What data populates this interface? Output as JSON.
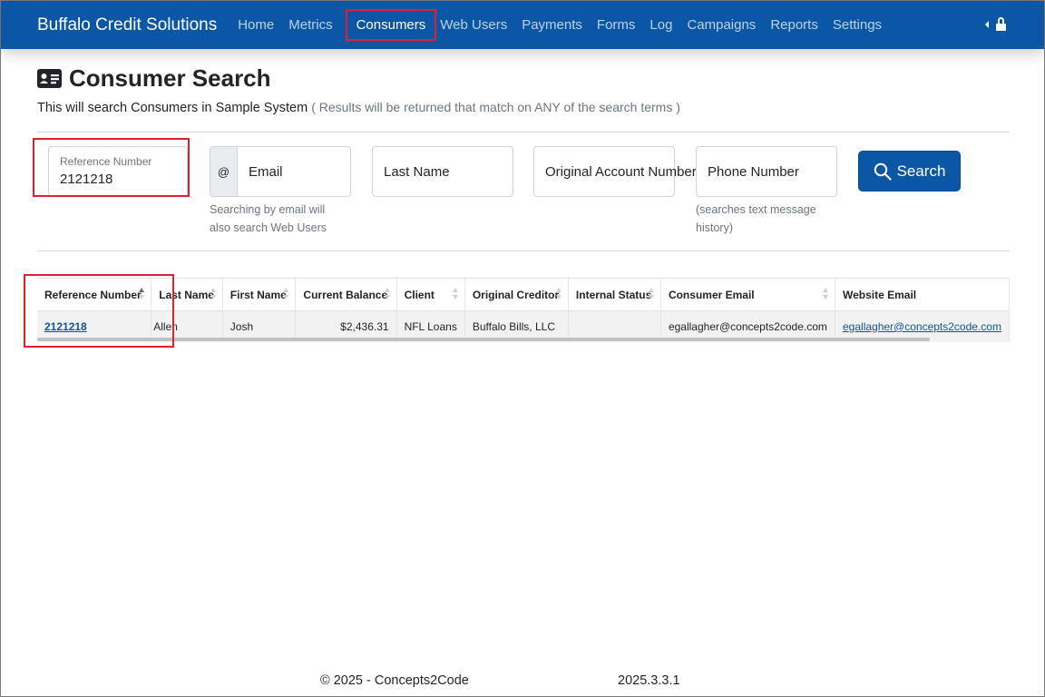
{
  "navbar": {
    "brand": "Buffalo Credit Solutions",
    "items": [
      {
        "label": "Home"
      },
      {
        "label": "Metrics"
      },
      {
        "label": "Consumers"
      },
      {
        "label": "Web Users"
      },
      {
        "label": "Payments"
      },
      {
        "label": "Forms"
      },
      {
        "label": "Log"
      },
      {
        "label": "Campaigns"
      },
      {
        "label": "Reports"
      },
      {
        "label": "Settings"
      }
    ],
    "active": "Consumers",
    "icons": [
      "caret-left-icon",
      "lock-icon"
    ]
  },
  "page": {
    "title": "Consumer Search",
    "title_icon": "id-card-icon",
    "subtitle": "This will search Consumers in Sample System",
    "subtitle_note": "( Results will be returned that match on ANY of the search terms )"
  },
  "search": {
    "reference_label": "Reference Number",
    "reference_value": "2121218",
    "email_addon": "@",
    "email_placeholder": "Email",
    "email_help": "Searching by email will also search Web Users",
    "last_name_placeholder": "Last Name",
    "original_account_placeholder": "Original Account Number",
    "phone_placeholder": "Phone Number",
    "phone_help": "(searches text message history)",
    "button_label": "Search",
    "button_icon": "search-icon"
  },
  "results": {
    "columns": [
      "Reference Number",
      "Last Name",
      "First Name",
      "Current Balance",
      "Client",
      "Original Creditor",
      "Internal Status",
      "Consumer Email",
      "Website Email"
    ],
    "rows": [
      {
        "reference": "2121218",
        "last_name": "Allen",
        "first_name": "Josh",
        "balance": "$2,436.31",
        "client": "NFL Loans",
        "creditor": "Buffalo Bills, LLC",
        "internal_status": "",
        "consumer_email": "egallagher@concepts2code.com",
        "website_email": "egallagher@concepts2code.com"
      }
    ]
  },
  "footer": {
    "copyright": "© 2025 - Concepts2Code",
    "version": "2025.3.3.1"
  },
  "colors": {
    "navbar": "#0b56a5",
    "highlight": "#e0202a",
    "link": "#0b56a5"
  }
}
